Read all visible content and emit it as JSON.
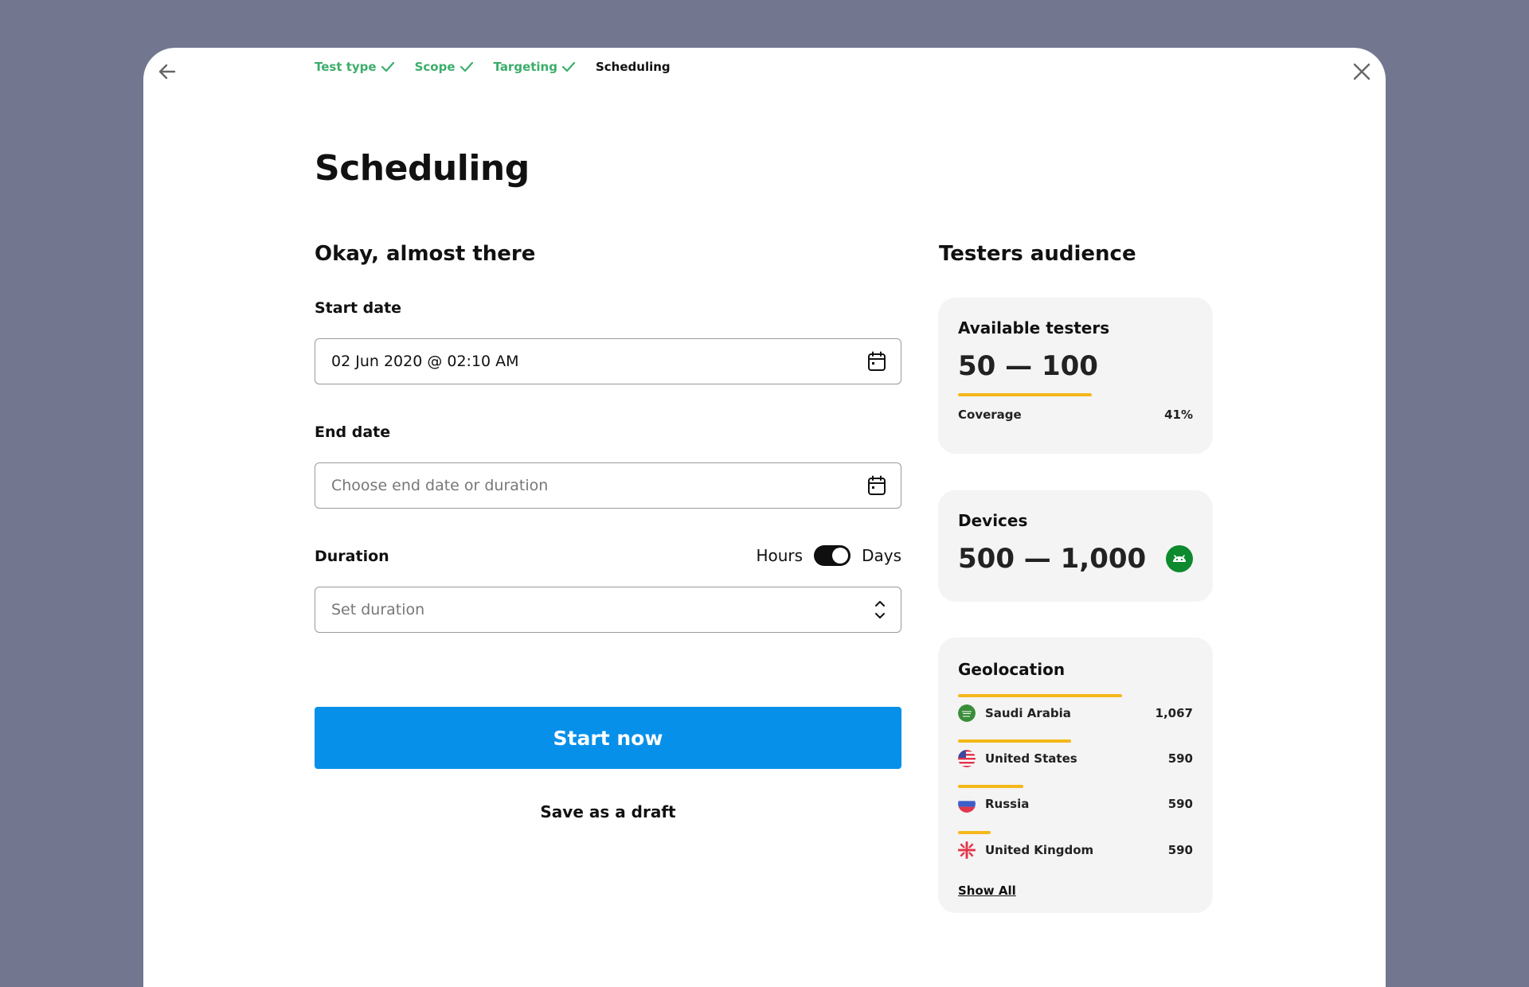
{
  "stepper": {
    "steps": [
      {
        "label": "Test type",
        "state": "done"
      },
      {
        "label": "Scope",
        "state": "done"
      },
      {
        "label": "Targeting",
        "state": "done"
      },
      {
        "label": "Scheduling",
        "state": "current"
      }
    ]
  },
  "page": {
    "title": "Scheduling",
    "subtitle": "Okay, almost there"
  },
  "form": {
    "start_date": {
      "label": "Start date",
      "value": "02 Jun 2020 @ 02:10 AM"
    },
    "end_date": {
      "label": "End date",
      "placeholder": "Choose end date or duration"
    },
    "duration": {
      "label": "Duration",
      "toggle_left": "Hours",
      "toggle_right": "Days",
      "toggle_selected": "Days",
      "placeholder": "Set duration"
    },
    "start_button": "Start now",
    "draft_button": "Save as a draft"
  },
  "audience": {
    "title": "Testers audience",
    "available": {
      "title": "Available testers",
      "range": "50 — 100",
      "coverage_label": "Coverage",
      "coverage_value": "41%",
      "coverage_fraction": 0.41
    },
    "devices": {
      "title": "Devices",
      "range": "500 — 1,000",
      "platform_icon": "android-icon"
    },
    "geolocation": {
      "title": "Geolocation",
      "items": [
        {
          "country": "Saudi Arabia",
          "count": "1,067",
          "share": 1.0,
          "flag": "saudi-arabia-flag-icon"
        },
        {
          "country": "United States",
          "count": "590",
          "share": 0.69,
          "flag": "united-states-flag-icon"
        },
        {
          "country": "Russia",
          "count": "590",
          "share": 0.4,
          "flag": "russia-flag-icon"
        },
        {
          "country": "United Kingdom",
          "count": "590",
          "share": 0.2,
          "flag": "united-kingdom-flag-icon"
        }
      ],
      "show_all": "Show All"
    }
  },
  "colors": {
    "background": "#72768f",
    "accent": "#0690ea",
    "done": "#3cae6b",
    "bar": "#f5b81b",
    "android": "#0d8a2d"
  }
}
